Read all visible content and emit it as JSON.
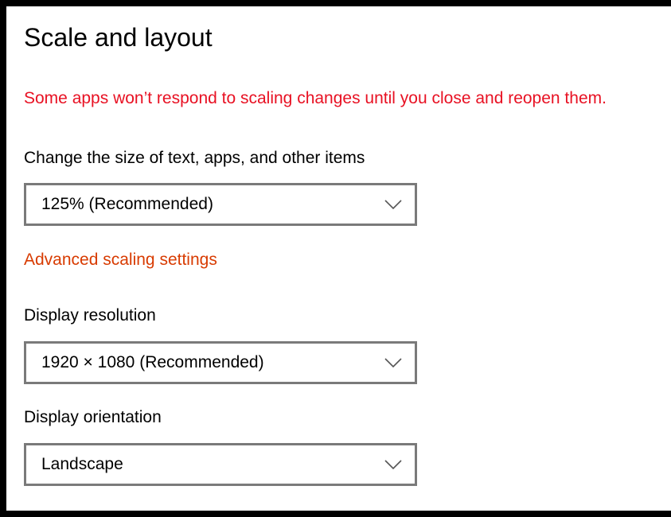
{
  "section": {
    "title": "Scale and layout",
    "warning": "Some apps won’t respond to scaling changes until you close and reopen them."
  },
  "scale": {
    "label": "Change the size of text, apps, and other items",
    "selected": "125% (Recommended)"
  },
  "advanced_link": "Advanced scaling settings",
  "resolution": {
    "label": "Display resolution",
    "selected": "1920 × 1080 (Recommended)"
  },
  "orientation": {
    "label": "Display orientation",
    "selected": "Landscape"
  },
  "icons": {
    "dropdown": "chevron-down-icon"
  },
  "colors": {
    "warning": "#e81123",
    "link": "#d83b01",
    "dropdown_border": "#7a7a7a",
    "frame": "#000000",
    "background": "#ffffff"
  }
}
